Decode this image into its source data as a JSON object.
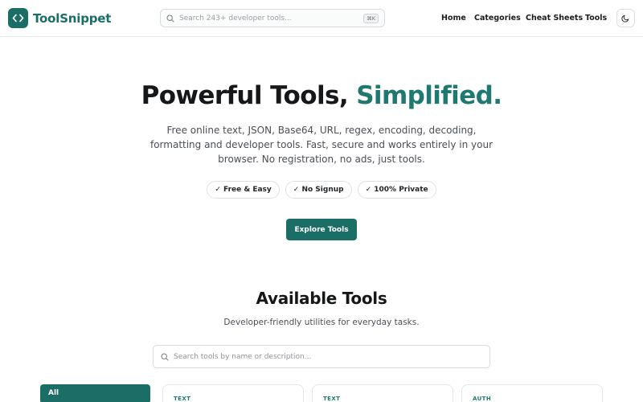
{
  "brand": {
    "name": "ToolSnippet",
    "color": "#1b6e66"
  },
  "header": {
    "search_placeholder": "Search 243+ developer tools...",
    "shortcut": "⌘K",
    "nav": [
      "Home",
      "Categories",
      "Cheat Sheets",
      "Tools"
    ],
    "theme_icon": "moon-icon"
  },
  "hero": {
    "title_main": "Powerful Tools,",
    "title_accent": "Simplified.",
    "description": "Free online text, JSON, Base64, URL, regex, encoding, decoding, formatting and developer tools. Fast, secure and works entirely in your browser. No registration, no ads, just tools.",
    "badges": [
      "✓ Free & Easy",
      "✓ No Signup",
      "✓ 100% Private"
    ],
    "cta": "Explore Tools"
  },
  "tools_section": {
    "title": "Available Tools",
    "subtitle": "Developer-friendly utilities for everyday tasks.",
    "search_placeholder": "Search tools by name or description...",
    "filters": [
      "All"
    ],
    "cards": [
      {
        "category": "TEXT"
      },
      {
        "category": "TEXT"
      },
      {
        "category": "AUTH"
      }
    ]
  },
  "colors": {
    "accent": "#1e7a70",
    "primary_button": "#1b6e66"
  }
}
